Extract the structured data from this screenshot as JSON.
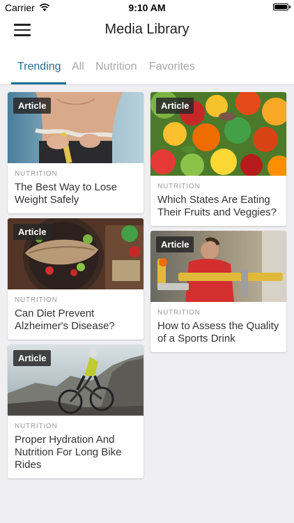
{
  "status_bar": {
    "carrier": "Carrier",
    "time": "9:10 AM"
  },
  "header": {
    "title": "Media Library",
    "menu_icon": "hamburger-menu-icon"
  },
  "tabs": [
    {
      "label": "Trending",
      "active": true
    },
    {
      "label": "All",
      "active": false
    },
    {
      "label": "Nutrition",
      "active": false
    },
    {
      "label": "Favorites",
      "active": false
    }
  ],
  "colors": {
    "accent": "#1f6f95",
    "background": "#efeff1",
    "tab_inactive": "#a7a7ab"
  },
  "cards": [
    {
      "badge": "Article",
      "category": "NUTRITION",
      "title": "The Best Way to Lose Weight Safely",
      "image": "measuring-tape-waist-photo"
    },
    {
      "badge": "Article",
      "category": "NUTRITION",
      "title": "Which States Are Eating Their Fruits and Veggies?",
      "image": "vegetables-photo"
    },
    {
      "badge": "Article",
      "category": "NUTRITION",
      "title": "Can Diet Prevent Alzheimer's Disease?",
      "image": "fish-salad-plate-photo"
    },
    {
      "badge": "Article",
      "category": "NUTRITION",
      "title": "How to Assess the Quality of a Sports Drink",
      "image": "athlete-gym-photo"
    },
    {
      "badge": "Article",
      "category": "NUTRITION",
      "title": "Proper Hydration And Nutrition For Long Bike Rides",
      "image": "mountain-biker-photo"
    }
  ]
}
